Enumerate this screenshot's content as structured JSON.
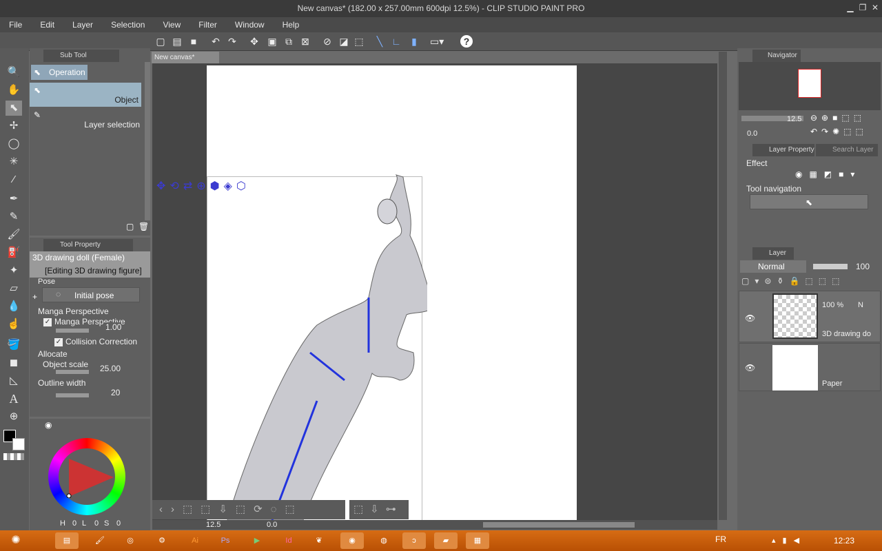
{
  "window": {
    "title": "New canvas* (182.00 x 257.00mm 600dpi 12.5%) - CLIP STUDIO PAINT PRO"
  },
  "menu": [
    "File",
    "Edit",
    "Layer",
    "Selection",
    "View",
    "Filter",
    "Window",
    "Help"
  ],
  "subtool": {
    "tab": "Sub Tool",
    "operation": "Operation",
    "items": [
      "Object",
      "Layer selection"
    ]
  },
  "toolprop": {
    "tab": "Tool Property",
    "subject": "3D drawing doll (Female)",
    "mode": "[Editing 3D drawing figure]",
    "pose": "Pose",
    "initial_pose": "Initial pose",
    "manga_perspective": "Manga Perspective",
    "manga_perspective_check": "Manga Perspective",
    "manga_value": "1.00",
    "collision": "Collision Correction",
    "allocate": "Allocate",
    "object_scale": "Object scale",
    "object_scale_value": "25.00",
    "outline_width": "Outline width",
    "outline_value": "20"
  },
  "color": {
    "h": "H",
    "h_val": "0",
    "l": "L",
    "l_val": "0",
    "s": "S",
    "s_val": "0"
  },
  "canvas": {
    "tab": "New canvas*",
    "zoom": "12.5",
    "angle": "0.0"
  },
  "navigator": {
    "tab": "Navigator",
    "zoom": "12.5",
    "rotate": "0.0"
  },
  "layerprop": {
    "tab": "Layer Property",
    "tab2": "Search Layer",
    "effect": "Effect",
    "toolnav": "Tool navigation"
  },
  "layer": {
    "tab": "Layer",
    "blend": "Normal",
    "opacity": "100",
    "l1_opacity": "100 %",
    "l1_extra": "N",
    "l1_name": "3D drawing do",
    "l2_name": "Paper"
  },
  "taskbar": {
    "lang": "FR",
    "time": "12:23"
  }
}
